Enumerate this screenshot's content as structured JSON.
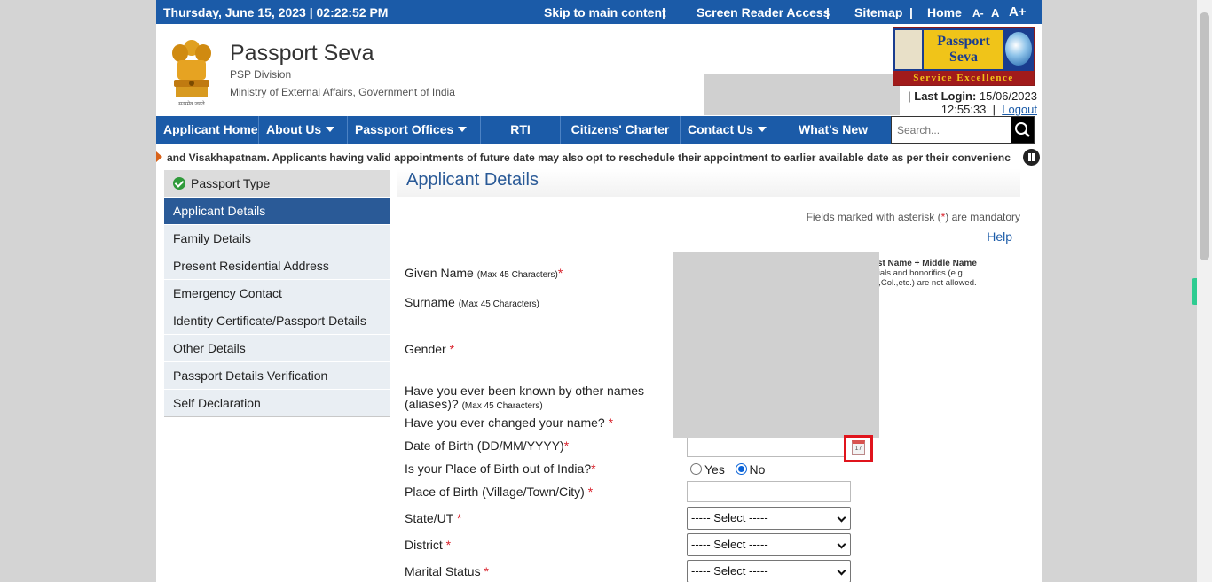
{
  "topbar": {
    "datetime": "Thursday,  June  15, 2023 | 02:22:52 PM",
    "skip": "Skip to main content",
    "screen_reader": "Screen Reader Access",
    "sitemap": "Sitemap",
    "home": "Home",
    "font_small": "A-",
    "font_normal": "A",
    "font_large": "A+",
    "separator": "|"
  },
  "header": {
    "title": "Passport Seva",
    "subtitle": "PSP Division",
    "ministry": "Ministry of External Affairs, Government of India",
    "emblem_caption": "सत्यमेव जयते",
    "logo_line1": "Passport",
    "logo_line2": "Seva",
    "logo_band": "Service Excellence",
    "last_login_label": "Last Login:",
    "last_login_date": "15/06/2023",
    "last_login_time": "12:55:33",
    "logout": "Logout"
  },
  "nav": {
    "items": [
      {
        "label": "Applicant Home",
        "dropdown": false
      },
      {
        "label": "About Us",
        "dropdown": true
      },
      {
        "label": "Passport Offices",
        "dropdown": true
      },
      {
        "label": "RTI",
        "dropdown": false
      },
      {
        "label": "Citizens' Charter",
        "dropdown": false
      },
      {
        "label": "Contact Us",
        "dropdown": true
      },
      {
        "label": "What's New",
        "dropdown": false
      }
    ],
    "search_placeholder": "Search..."
  },
  "marquee": "and Visakhapatnam. Applicants having valid appointments of future date may also opt to reschedule their appointment to earlier available date as per their convenience.",
  "sidebar": {
    "items": [
      {
        "label": "Passport Type",
        "state": "done"
      },
      {
        "label": "Applicant Details",
        "state": "active"
      },
      {
        "label": "Family Details",
        "state": ""
      },
      {
        "label": "Present Residential Address",
        "state": ""
      },
      {
        "label": "Emergency Contact",
        "state": ""
      },
      {
        "label": "Identity Certificate/Passport Details",
        "state": ""
      },
      {
        "label": "Other Details",
        "state": ""
      },
      {
        "label": "Passport Details Verification",
        "state": ""
      },
      {
        "label": "Self Declaration",
        "state": ""
      }
    ]
  },
  "main": {
    "title": "Applicant Details",
    "mandatory_pre": "Fields marked with asterisk (",
    "mandatory_ast": "*",
    "mandatory_post": ") are mandatory",
    "help": "Help",
    "hint_bold": "rst Name + Middle Name",
    "hint_text": "itials and honorifics (e.g. r.,Col.,etc.) are not allowed.",
    "fields": {
      "given_name": "Given Name",
      "given_name_note": "(Max 45 Characters)",
      "surname": "Surname",
      "surname_note": "(Max 45 Characters)",
      "gender": "Gender",
      "aliases_line1": "Have you ever been known by other names",
      "aliases_line2": "(aliases)?",
      "aliases_note": "(Max 45 Characters)",
      "changed_name": "Have you ever changed your name?",
      "dob": "Date of Birth (DD/MM/YYYY)",
      "pob_out": "Is your Place of Birth out of India?",
      "pob": "Place of Birth (Village/Town/City)",
      "state": "State/UT",
      "district": "District",
      "marital": "Marital Status"
    },
    "radio_yes": "Yes",
    "radio_no": "No",
    "radio_selected": "No",
    "calendar_day": "17",
    "select_default": "----- Select -----",
    "asterisk": "*"
  }
}
